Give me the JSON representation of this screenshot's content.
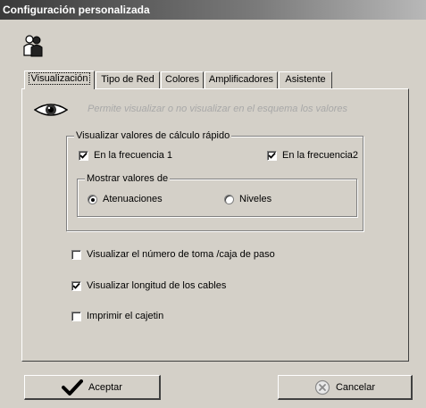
{
  "window": {
    "title": "Configuración personalizada"
  },
  "icons": {
    "user": "users-icon",
    "eye": "eye-icon",
    "accept": "checkmark-icon",
    "cancel": "cancel-icon"
  },
  "tabs": [
    {
      "label": "Visualización",
      "active": true
    },
    {
      "label": "Tipo de Red"
    },
    {
      "label": "Colores"
    },
    {
      "label": "Amplificadores"
    },
    {
      "label": "Asistente"
    }
  ],
  "panel": {
    "info_text": "Permite visualizar o no visualizar en el esquema los valores",
    "quick_calc": {
      "legend": "Visualizar valores de cálculo rápido",
      "freq1": {
        "label": "En la frecuencia 1",
        "checked": true
      },
      "freq2": {
        "label": "En la frecuencia2",
        "checked": true
      },
      "show_values": {
        "legend": "Mostrar valores de",
        "attenuations": {
          "label": "Atenuaciones",
          "selected": true
        },
        "levels": {
          "label": "Niveles",
          "selected": false
        }
      }
    },
    "options": [
      {
        "label": "Visualizar el número de toma /caja de paso",
        "checked": false
      },
      {
        "label": "Visualizar longitud de los cables",
        "checked": true
      },
      {
        "label": "Imprimir el cajetin",
        "checked": false
      }
    ]
  },
  "buttons": {
    "accept": "Aceptar",
    "cancel": "Cancelar"
  }
}
